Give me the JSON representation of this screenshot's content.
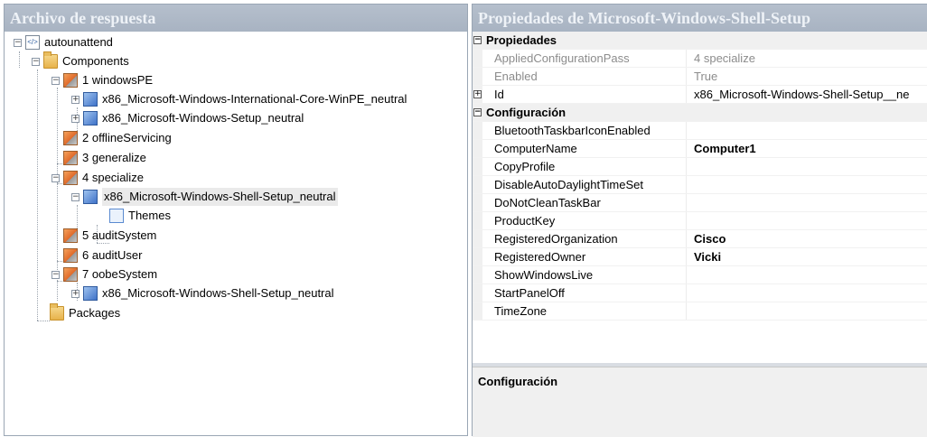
{
  "left_pane": {
    "title": "Archivo de respuesta",
    "tree": [
      {
        "label": "autounattend",
        "icon": "xml-file-icon",
        "expander": "−"
      },
      {
        "label": "Components",
        "icon": "folder-icon",
        "expander": "−"
      },
      {
        "label": "1 windowsPE",
        "icon": "config-pass-icon",
        "expander": "−"
      },
      {
        "label": "x86_Microsoft-Windows-International-Core-WinPE_neutral",
        "icon": "component-icon",
        "expander": "+"
      },
      {
        "label": "x86_Microsoft-Windows-Setup_neutral",
        "icon": "component-icon",
        "expander": "+"
      },
      {
        "label": "2 offlineServicing",
        "icon": "config-pass-icon",
        "expander": ""
      },
      {
        "label": "3 generalize",
        "icon": "config-pass-icon",
        "expander": ""
      },
      {
        "label": "4 specialize",
        "icon": "config-pass-icon",
        "expander": "−"
      },
      {
        "label": "x86_Microsoft-Windows-Shell-Setup_neutral",
        "icon": "component-icon",
        "expander": "−"
      },
      {
        "label": "Themes",
        "icon": "setting-group-icon",
        "expander": ""
      },
      {
        "label": "5 auditSystem",
        "icon": "config-pass-icon",
        "expander": ""
      },
      {
        "label": "6 auditUser",
        "icon": "config-pass-icon",
        "expander": ""
      },
      {
        "label": "7 oobeSystem",
        "icon": "config-pass-icon",
        "expander": "−"
      },
      {
        "label": "x86_Microsoft-Windows-Shell-Setup_neutral",
        "icon": "component-icon",
        "expander": "+"
      },
      {
        "label": "Packages",
        "icon": "folder-icon",
        "expander": ""
      }
    ]
  },
  "right_pane": {
    "title": "Propiedades de Microsoft-Windows-Shell-Setup",
    "categories": {
      "propiedades": {
        "label": "Propiedades",
        "expander": "−"
      },
      "configuracion": {
        "label": "Configuración",
        "expander": "−"
      }
    },
    "properties": [
      {
        "name": "AppliedConfigurationPass",
        "value": "4 specialize"
      },
      {
        "name": "Enabled",
        "value": "True"
      },
      {
        "name": "Id",
        "value": "x86_Microsoft-Windows-Shell-Setup__ne",
        "expander": "+"
      }
    ],
    "settings": [
      {
        "name": "BluetoothTaskbarIconEnabled",
        "value": ""
      },
      {
        "name": "ComputerName",
        "value": "Computer1"
      },
      {
        "name": "CopyProfile",
        "value": ""
      },
      {
        "name": "DisableAutoDaylightTimeSet",
        "value": ""
      },
      {
        "name": "DoNotCleanTaskBar",
        "value": ""
      },
      {
        "name": "ProductKey",
        "value": ""
      },
      {
        "name": "RegisteredOrganization",
        "value": "Cisco"
      },
      {
        "name": "RegisteredOwner",
        "value": "Vicki"
      },
      {
        "name": "ShowWindowsLive",
        "value": ""
      },
      {
        "name": "StartPanelOff",
        "value": ""
      },
      {
        "name": "TimeZone",
        "value": ""
      }
    ],
    "help": {
      "title": "Configuración"
    }
  }
}
